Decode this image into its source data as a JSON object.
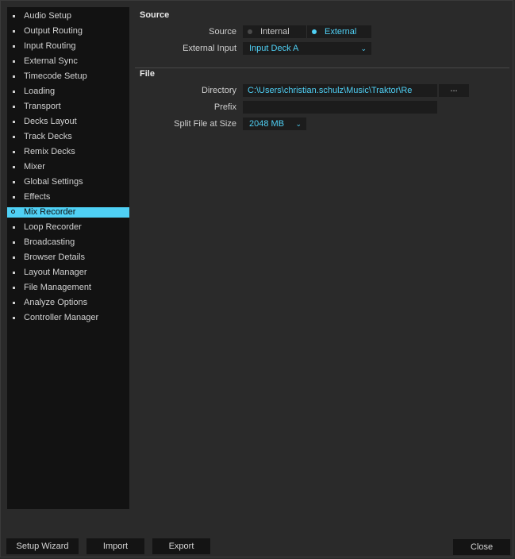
{
  "sidebar": {
    "items": [
      {
        "label": "Audio Setup"
      },
      {
        "label": "Output Routing"
      },
      {
        "label": "Input Routing"
      },
      {
        "label": "External Sync"
      },
      {
        "label": "Timecode Setup"
      },
      {
        "label": "Loading"
      },
      {
        "label": "Transport"
      },
      {
        "label": "Decks Layout"
      },
      {
        "label": "Track Decks"
      },
      {
        "label": "Remix Decks"
      },
      {
        "label": "Mixer"
      },
      {
        "label": "Global Settings"
      },
      {
        "label": "Effects"
      },
      {
        "label": "Mix Recorder",
        "active": true
      },
      {
        "label": "Loop Recorder"
      },
      {
        "label": "Broadcasting"
      },
      {
        "label": "Browser Details"
      },
      {
        "label": "Layout Manager"
      },
      {
        "label": "File Management"
      },
      {
        "label": "Analyze Options"
      },
      {
        "label": "Controller Manager"
      }
    ]
  },
  "source_section": {
    "title": "Source",
    "source_label": "Source",
    "source_options": [
      {
        "label": "Internal",
        "selected": false
      },
      {
        "label": "External",
        "selected": true
      }
    ],
    "external_input_label": "External Input",
    "external_input_value": "Input Deck A"
  },
  "file_section": {
    "title": "File",
    "directory_label": "Directory",
    "directory_value": "C:\\Users\\christian.schulz\\Music\\Traktor\\Re",
    "browse_label": "...",
    "prefix_label": "Prefix",
    "prefix_value": "",
    "split_label": "Split File at Size",
    "split_value": "2048 MB"
  },
  "footer": {
    "setup_wizard": "Setup Wizard",
    "import": "Import",
    "export": "Export",
    "close": "Close"
  },
  "colors": {
    "accent": "#4fd0f5",
    "background": "#2a2a2a",
    "sidebar_bg": "#121212",
    "field_bg": "#1c1c1c"
  },
  "icons": {
    "sidebar_bullet": "bullet-icon",
    "dropdown": "chevron-down-icon",
    "radio": "radio-dot-icon"
  }
}
